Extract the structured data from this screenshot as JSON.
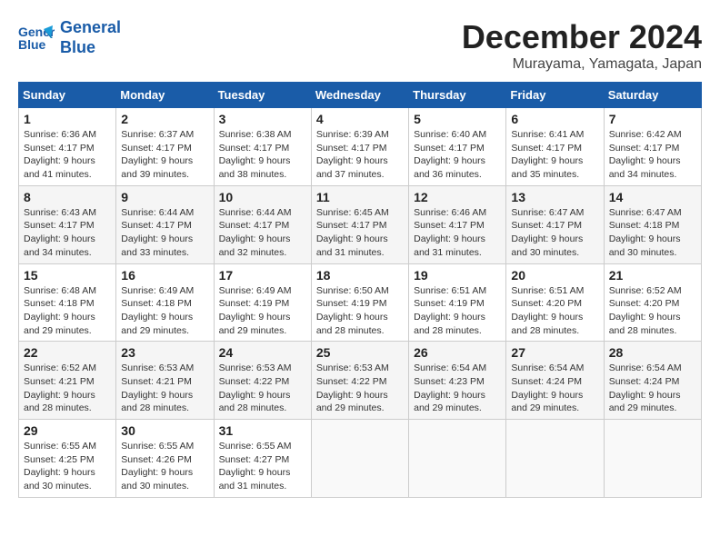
{
  "header": {
    "logo_line1": "General",
    "logo_line2": "Blue",
    "month": "December 2024",
    "location": "Murayama, Yamagata, Japan"
  },
  "weekdays": [
    "Sunday",
    "Monday",
    "Tuesday",
    "Wednesday",
    "Thursday",
    "Friday",
    "Saturday"
  ],
  "weeks": [
    [
      {
        "day": "1",
        "info": "Sunrise: 6:36 AM\nSunset: 4:17 PM\nDaylight: 9 hours\nand 41 minutes."
      },
      {
        "day": "2",
        "info": "Sunrise: 6:37 AM\nSunset: 4:17 PM\nDaylight: 9 hours\nand 39 minutes."
      },
      {
        "day": "3",
        "info": "Sunrise: 6:38 AM\nSunset: 4:17 PM\nDaylight: 9 hours\nand 38 minutes."
      },
      {
        "day": "4",
        "info": "Sunrise: 6:39 AM\nSunset: 4:17 PM\nDaylight: 9 hours\nand 37 minutes."
      },
      {
        "day": "5",
        "info": "Sunrise: 6:40 AM\nSunset: 4:17 PM\nDaylight: 9 hours\nand 36 minutes."
      },
      {
        "day": "6",
        "info": "Sunrise: 6:41 AM\nSunset: 4:17 PM\nDaylight: 9 hours\nand 35 minutes."
      },
      {
        "day": "7",
        "info": "Sunrise: 6:42 AM\nSunset: 4:17 PM\nDaylight: 9 hours\nand 34 minutes."
      }
    ],
    [
      {
        "day": "8",
        "info": "Sunrise: 6:43 AM\nSunset: 4:17 PM\nDaylight: 9 hours\nand 34 minutes."
      },
      {
        "day": "9",
        "info": "Sunrise: 6:44 AM\nSunset: 4:17 PM\nDaylight: 9 hours\nand 33 minutes."
      },
      {
        "day": "10",
        "info": "Sunrise: 6:44 AM\nSunset: 4:17 PM\nDaylight: 9 hours\nand 32 minutes."
      },
      {
        "day": "11",
        "info": "Sunrise: 6:45 AM\nSunset: 4:17 PM\nDaylight: 9 hours\nand 31 minutes."
      },
      {
        "day": "12",
        "info": "Sunrise: 6:46 AM\nSunset: 4:17 PM\nDaylight: 9 hours\nand 31 minutes."
      },
      {
        "day": "13",
        "info": "Sunrise: 6:47 AM\nSunset: 4:17 PM\nDaylight: 9 hours\nand 30 minutes."
      },
      {
        "day": "14",
        "info": "Sunrise: 6:47 AM\nSunset: 4:18 PM\nDaylight: 9 hours\nand 30 minutes."
      }
    ],
    [
      {
        "day": "15",
        "info": "Sunrise: 6:48 AM\nSunset: 4:18 PM\nDaylight: 9 hours\nand 29 minutes."
      },
      {
        "day": "16",
        "info": "Sunrise: 6:49 AM\nSunset: 4:18 PM\nDaylight: 9 hours\nand 29 minutes."
      },
      {
        "day": "17",
        "info": "Sunrise: 6:49 AM\nSunset: 4:19 PM\nDaylight: 9 hours\nand 29 minutes."
      },
      {
        "day": "18",
        "info": "Sunrise: 6:50 AM\nSunset: 4:19 PM\nDaylight: 9 hours\nand 28 minutes."
      },
      {
        "day": "19",
        "info": "Sunrise: 6:51 AM\nSunset: 4:19 PM\nDaylight: 9 hours\nand 28 minutes."
      },
      {
        "day": "20",
        "info": "Sunrise: 6:51 AM\nSunset: 4:20 PM\nDaylight: 9 hours\nand 28 minutes."
      },
      {
        "day": "21",
        "info": "Sunrise: 6:52 AM\nSunset: 4:20 PM\nDaylight: 9 hours\nand 28 minutes."
      }
    ],
    [
      {
        "day": "22",
        "info": "Sunrise: 6:52 AM\nSunset: 4:21 PM\nDaylight: 9 hours\nand 28 minutes."
      },
      {
        "day": "23",
        "info": "Sunrise: 6:53 AM\nSunset: 4:21 PM\nDaylight: 9 hours\nand 28 minutes."
      },
      {
        "day": "24",
        "info": "Sunrise: 6:53 AM\nSunset: 4:22 PM\nDaylight: 9 hours\nand 28 minutes."
      },
      {
        "day": "25",
        "info": "Sunrise: 6:53 AM\nSunset: 4:22 PM\nDaylight: 9 hours\nand 29 minutes."
      },
      {
        "day": "26",
        "info": "Sunrise: 6:54 AM\nSunset: 4:23 PM\nDaylight: 9 hours\nand 29 minutes."
      },
      {
        "day": "27",
        "info": "Sunrise: 6:54 AM\nSunset: 4:24 PM\nDaylight: 9 hours\nand 29 minutes."
      },
      {
        "day": "28",
        "info": "Sunrise: 6:54 AM\nSunset: 4:24 PM\nDaylight: 9 hours\nand 29 minutes."
      }
    ],
    [
      {
        "day": "29",
        "info": "Sunrise: 6:55 AM\nSunset: 4:25 PM\nDaylight: 9 hours\nand 30 minutes."
      },
      {
        "day": "30",
        "info": "Sunrise: 6:55 AM\nSunset: 4:26 PM\nDaylight: 9 hours\nand 30 minutes."
      },
      {
        "day": "31",
        "info": "Sunrise: 6:55 AM\nSunset: 4:27 PM\nDaylight: 9 hours\nand 31 minutes."
      },
      null,
      null,
      null,
      null
    ]
  ]
}
